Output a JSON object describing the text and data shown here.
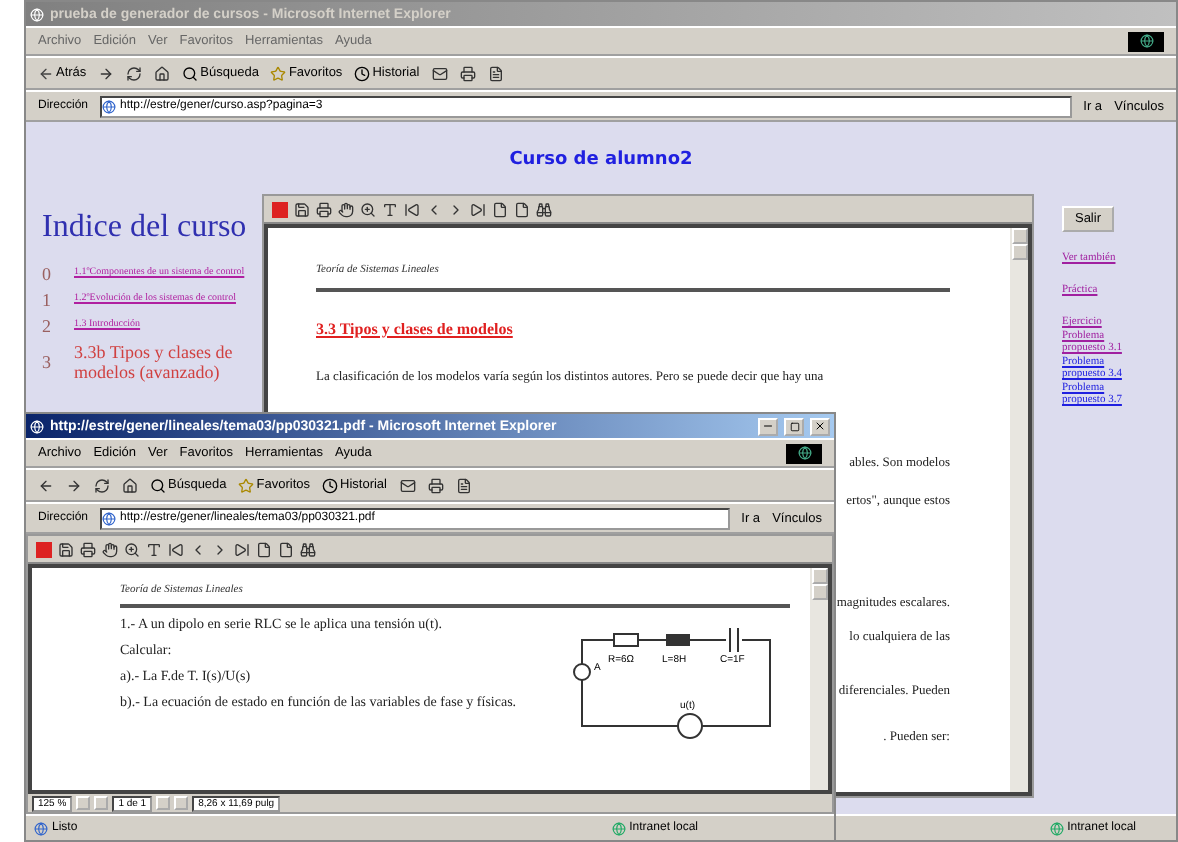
{
  "back_window": {
    "title": "prueba de generador de cursos - Microsoft Internet Explorer",
    "active": false,
    "menu": [
      "Archivo",
      "Edición",
      "Ver",
      "Favoritos",
      "Herramientas",
      "Ayuda"
    ],
    "toolbar": {
      "back": "Atrás",
      "search": "Búsqueda",
      "favorites": "Favoritos",
      "history": "Historial"
    },
    "address": {
      "label": "Dirección",
      "value": "http://estre/gener/curso.asp?pagina=3",
      "go": "Ir a",
      "links": "Vínculos"
    },
    "page": {
      "heading": "Curso de alumno2",
      "index_title": "Indice del curso",
      "index": [
        {
          "number": "0",
          "label": "1.1ºComponentes de un sistema de control",
          "kind": "link"
        },
        {
          "number": "1",
          "label": "1.2ºEvolución de los sistemas de control",
          "kind": "link"
        },
        {
          "number": "2",
          "label": "1.3 Introducción",
          "kind": "link"
        },
        {
          "number": "3",
          "label": "3.3b Tipos y clases de modelos (avanzado)",
          "kind": "current"
        }
      ],
      "pdf": {
        "header": "Teoría de Sistemas Lineales",
        "section_title": "3.3 Tipos y clases de modelos",
        "lines": [
          "La clasificación de los modelos varía según los distintos autores. Pero se puede decir que hay una",
          "ables.  Son modelos",
          "ertos\", aunque estos",
          "magnitudes escalares.",
          "lo cualquiera de las",
          "diferenciales. Pueden",
          ". Pueden ser:"
        ]
      },
      "exit_button": "Salir",
      "links": [
        {
          "label": "Ver también",
          "visited": true
        },
        {
          "label": "Práctica",
          "visited": true
        },
        {
          "label": "Ejercicio",
          "visited": true
        },
        {
          "label": "Problema propuesto 3.1",
          "visited": true
        },
        {
          "label": "Problema propuesto 3.4",
          "visited": false
        },
        {
          "label": "Problema propuesto 3.7",
          "visited": false
        }
      ]
    },
    "status": {
      "zone": "Intranet local"
    }
  },
  "front_window": {
    "title": "http://estre/gener/lineales/tema03/pp030321.pdf - Microsoft Internet Explorer",
    "active": true,
    "menu": [
      "Archivo",
      "Edición",
      "Ver",
      "Favoritos",
      "Herramientas",
      "Ayuda"
    ],
    "toolbar": {
      "search": "Búsqueda",
      "favorites": "Favoritos",
      "history": "Historial"
    },
    "address": {
      "label": "Dirección",
      "value": "http://estre/gener/lineales/tema03/pp030321.pdf",
      "go": "Ir a",
      "links": "Vínculos"
    },
    "pdf": {
      "header": "Teoría de Sistemas Lineales",
      "lines": [
        "1.- A un dipolo en serie RLC se le aplica  una tensión u(t).",
        "Calcular:",
        "a).- La F.de T.  I(s)/U(s)",
        "b).- La ecuación de estado en función de las variables de fase y físicas."
      ],
      "circuit": {
        "r": "R=6Ω",
        "l": "L=8H",
        "c": "C=1F",
        "node": "A",
        "source": "u(t)"
      },
      "zoom": "125 %",
      "page": "1 de 1",
      "size": "8,26 x 11,69 pulg"
    },
    "status": {
      "text": "Listo",
      "zone": "Intranet local"
    }
  }
}
